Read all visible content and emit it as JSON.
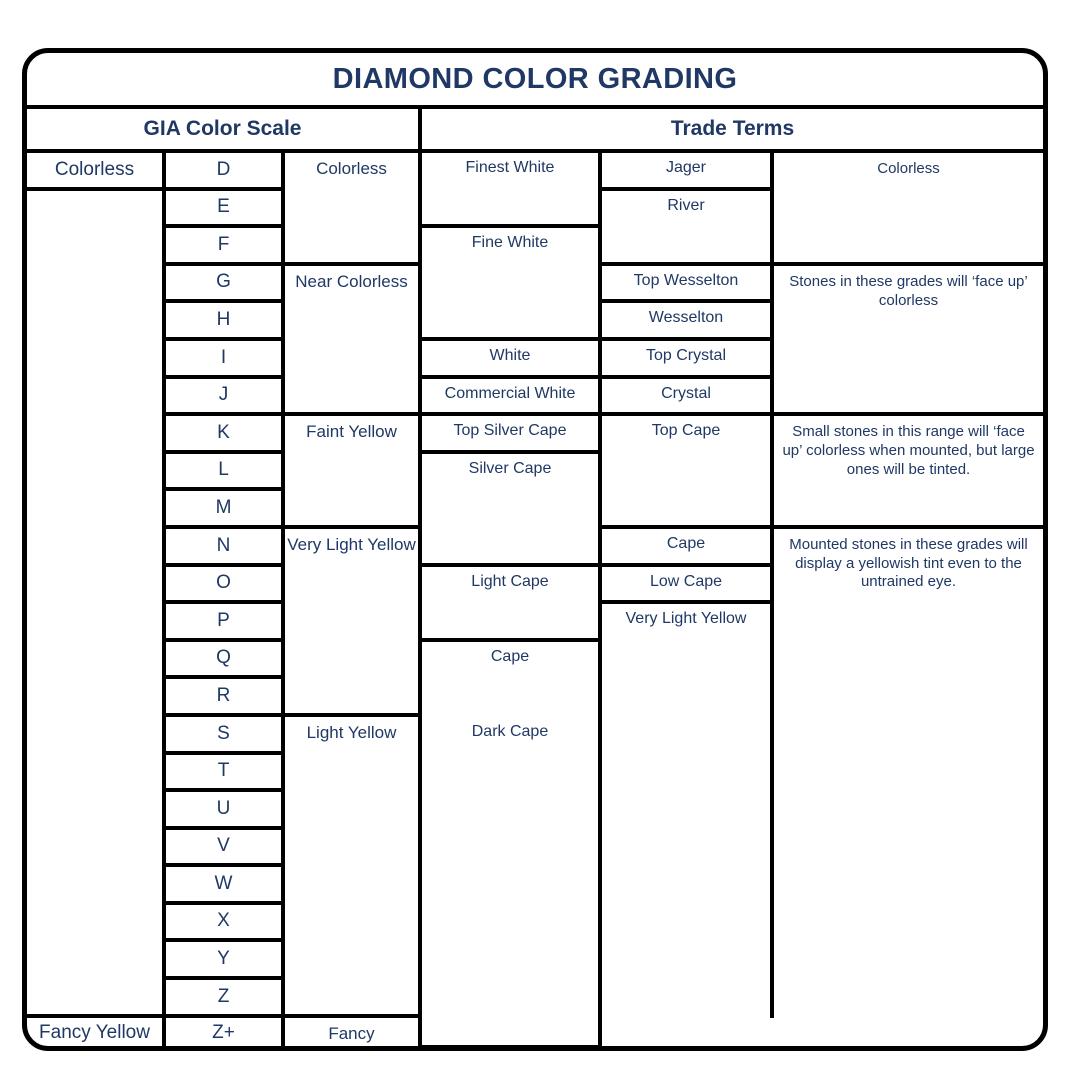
{
  "title": "DIAMOND COLOR GRADING",
  "colors": {
    "text_navy": "#1f3864",
    "border_black": "#000000",
    "background": "#ffffff"
  },
  "headers": {
    "gia_group": "GIA Color Scale",
    "trade_group": "Trade Terms"
  },
  "grades": [
    "D",
    "E",
    "F",
    "G",
    "H",
    "I",
    "J",
    "K",
    "L",
    "M",
    "N",
    "O",
    "P",
    "Q",
    "R",
    "S",
    "T",
    "U",
    "V",
    "W",
    "X",
    "Y",
    "Z",
    "Z+"
  ],
  "gia_categories": [
    {
      "label": "Colorless",
      "grades": [
        "D"
      ]
    },
    {
      "label": "Fancy Yellow",
      "grades": [
        "Z+"
      ]
    }
  ],
  "gia_descriptions": [
    {
      "label": "Colorless",
      "grades": [
        "D",
        "E",
        "F"
      ]
    },
    {
      "label": "Near Colorless",
      "grades": [
        "G",
        "H",
        "I",
        "J"
      ]
    },
    {
      "label": "Faint Yellow",
      "grades": [
        "K",
        "L",
        "M"
      ]
    },
    {
      "label": "Very Light Yellow",
      "grades": [
        "N",
        "O",
        "P",
        "Q",
        "R"
      ]
    },
    {
      "label": "Light Yellow",
      "grades": [
        "S",
        "T",
        "U",
        "V",
        "W",
        "X",
        "Y",
        "Z"
      ]
    },
    {
      "label": "Fancy",
      "grades": [
        "Z+"
      ]
    }
  ],
  "trade_terms_1": [
    {
      "label": "Finest White",
      "grades": [
        "D",
        "E"
      ]
    },
    {
      "label": "Fine White",
      "grades": [
        "F",
        "G",
        "H"
      ]
    },
    {
      "label": "White",
      "grades": [
        "I"
      ]
    },
    {
      "label": "Commercial White",
      "grades": [
        "J"
      ]
    },
    {
      "label": "Top Silver Cape",
      "grades": [
        "K"
      ]
    },
    {
      "label": "Silver Cape",
      "grades": [
        "L",
        "M",
        "N"
      ]
    },
    {
      "label": "Light Cape",
      "grades": [
        "O",
        "P"
      ]
    },
    {
      "label": "Cape",
      "grades": [
        "Q",
        "R"
      ]
    },
    {
      "label": "Dark Cape",
      "grades": [
        "S",
        "T",
        "U",
        "V",
        "W",
        "X",
        "Y",
        "Z"
      ]
    }
  ],
  "trade_terms_2": [
    {
      "label": "Jager",
      "grades": [
        "D"
      ]
    },
    {
      "label": "River",
      "grades": [
        "E",
        "F"
      ]
    },
    {
      "label": "Top Wesselton",
      "grades": [
        "G"
      ]
    },
    {
      "label": "Wesselton",
      "grades": [
        "H"
      ]
    },
    {
      "label": "Top Crystal",
      "grades": [
        "I"
      ]
    },
    {
      "label": "Crystal",
      "grades": [
        "J"
      ]
    },
    {
      "label": "Top Cape",
      "grades": [
        "K",
        "L",
        "M"
      ]
    },
    {
      "label": "Cape",
      "grades": [
        "N"
      ]
    },
    {
      "label": "Low Cape",
      "grades": [
        "O"
      ]
    },
    {
      "label": "Very Light Yellow",
      "grades": [
        "P",
        "Q",
        "R",
        "S",
        "T",
        "U",
        "V",
        "W",
        "X",
        "Y",
        "Z"
      ]
    }
  ],
  "appearance_notes": [
    {
      "text": "Colorless",
      "grades": [
        "D",
        "E",
        "F"
      ]
    },
    {
      "text": "Stones in these grades will ‘face up’ colorless",
      "grades": [
        "G",
        "H",
        "I",
        "J"
      ]
    },
    {
      "text": "Small stones in this range will ‘face up’ colorless when mounted, but large ones will be tinted.",
      "grades": [
        "K",
        "L",
        "M"
      ]
    },
    {
      "text": "Mounted stones in these grades will display a yellowish tint even to the untrained eye.",
      "grades": [
        "N",
        "O",
        "P",
        "Q",
        "R",
        "S",
        "T",
        "U",
        "V",
        "W",
        "X",
        "Y",
        "Z"
      ]
    }
  ]
}
